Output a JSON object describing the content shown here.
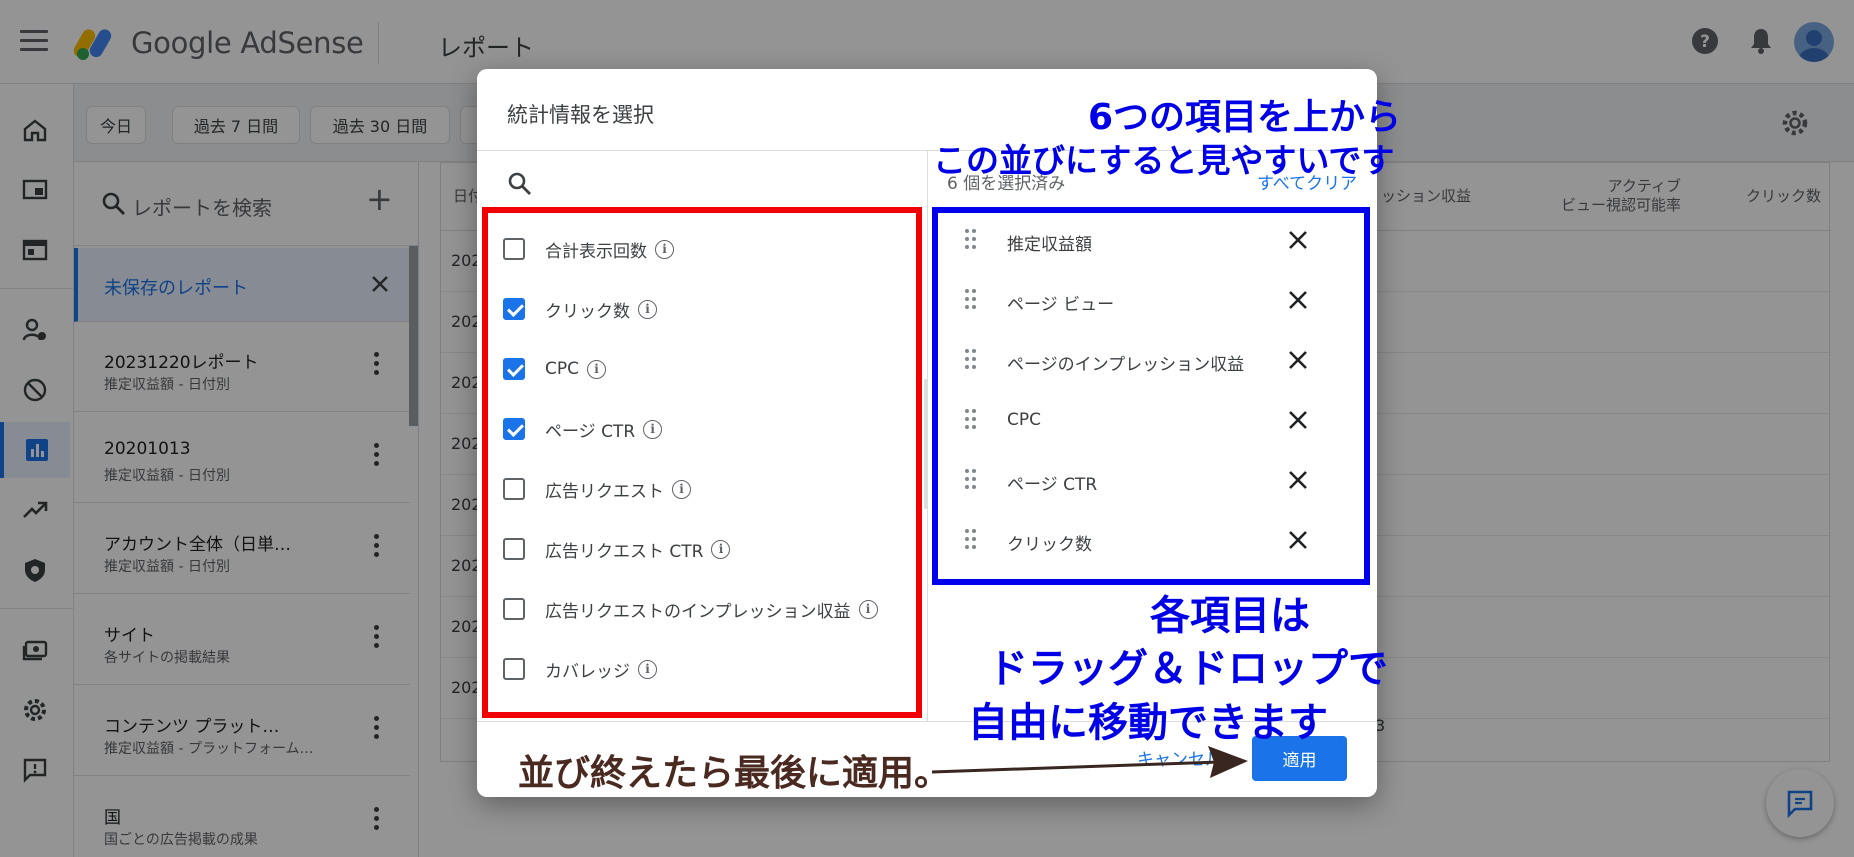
{
  "app": {
    "brand": "Google AdSense",
    "page_title": "レポート"
  },
  "date_chips": [
    "今日",
    "過去 7 日間",
    "過去 30 日間"
  ],
  "reports_panel": {
    "search_placeholder": "レポートを検索",
    "add_label": "+",
    "items": [
      {
        "title": "未保存のレポート",
        "subtitle": ""
      },
      {
        "title": "20231220レポート",
        "subtitle": "推定収益額 - 日付別"
      },
      {
        "title": "20201013",
        "subtitle": "推定収益額 - 日付別"
      },
      {
        "title": "アカウント全体（日単…",
        "subtitle": "推定収益額 - 日付別"
      },
      {
        "title": "サイト",
        "subtitle": "各サイトの掲載結果"
      },
      {
        "title": "コンテンツ プラット…",
        "subtitle": "推定収益額 - プラットフォーム…"
      },
      {
        "title": "国",
        "subtitle": "国ごとの広告掲載の成果"
      }
    ]
  },
  "table": {
    "header_first": "日付",
    "header_cols": [
      "ッション収益",
      "アクティブ\nビュー視認可能率",
      "クリック数"
    ],
    "row_prefix": [
      "202",
      "202",
      "202",
      "202",
      "202",
      "202",
      "202",
      "202"
    ],
    "footer_value": "3"
  },
  "dialog": {
    "title": "統計情報を選択",
    "options": [
      {
        "label": "合計表示回数",
        "checked": false
      },
      {
        "label": "クリック数",
        "checked": true
      },
      {
        "label": "CPC",
        "checked": true
      },
      {
        "label": "ページ CTR",
        "checked": true
      },
      {
        "label": "広告リクエスト",
        "checked": false
      },
      {
        "label": "広告リクエスト CTR",
        "checked": false
      },
      {
        "label": "広告リクエストのインプレッション収益",
        "checked": false
      },
      {
        "label": "カバレッジ",
        "checked": false
      }
    ],
    "selected_count": "6 個を選択済み",
    "clear_all": "すべてクリア",
    "selected": [
      "推定収益額",
      "ページ ビュー",
      "ページのインプレッション収益",
      "CPC",
      "ページ CTR",
      "クリック数"
    ],
    "cancel": "キャンセル",
    "apply": "適用"
  },
  "annotations": {
    "top_line1": "6つの項目を上から",
    "top_line2": "この並びにすると見やすいです",
    "mid_line1": "各項目は",
    "mid_line2": "ドラッグ＆ドロップで",
    "mid_line3": "自由に移動できます",
    "bottom": "並び終えたら最後に適用。"
  },
  "colors": {
    "accent": "#1a73e8",
    "annotation_red": "#f20000",
    "annotation_blue": "#0000ee",
    "annotation_brown": "#4a2a20"
  }
}
